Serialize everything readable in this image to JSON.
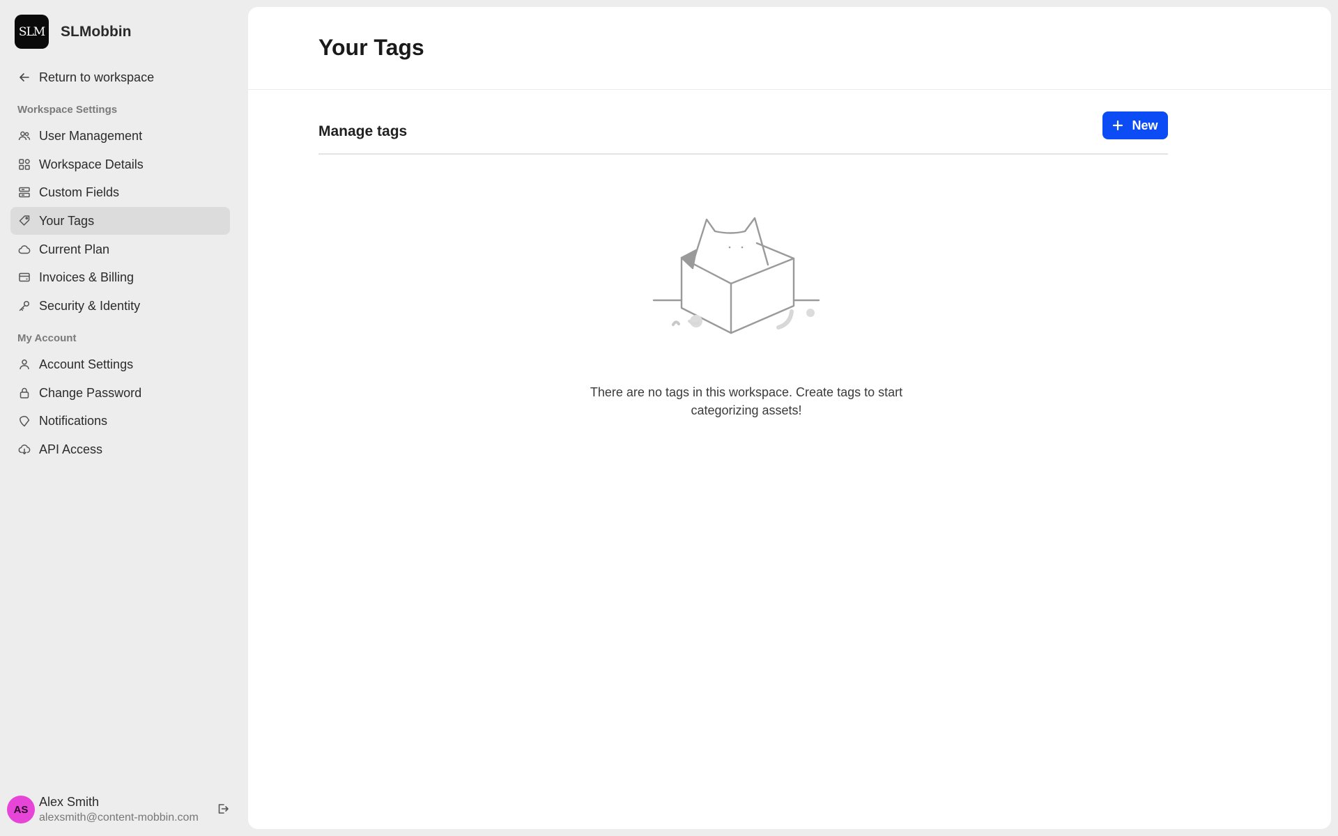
{
  "brand": {
    "logo_text": "SLM",
    "name": "SLMobbin"
  },
  "sidebar": {
    "return_label": "Return to workspace",
    "workspace_section": "Workspace Settings",
    "workspace_items": [
      {
        "label": "User Management",
        "icon": "users-icon"
      },
      {
        "label": "Workspace Details",
        "icon": "grid-icon"
      },
      {
        "label": "Custom Fields",
        "icon": "fields-icon"
      },
      {
        "label": "Your Tags",
        "icon": "tag-icon",
        "active": true
      },
      {
        "label": "Current Plan",
        "icon": "cloud-icon"
      },
      {
        "label": "Invoices & Billing",
        "icon": "card-icon"
      },
      {
        "label": "Security & Identity",
        "icon": "key-icon"
      }
    ],
    "account_section": "My Account",
    "account_items": [
      {
        "label": "Account Settings",
        "icon": "user-icon"
      },
      {
        "label": "Change Password",
        "icon": "lock-icon"
      },
      {
        "label": "Notifications",
        "icon": "bell-icon"
      },
      {
        "label": "API Access",
        "icon": "cloud-download-icon"
      }
    ]
  },
  "user": {
    "initials": "AS",
    "name": "Alex Smith",
    "email": "alexsmith@content-mobbin.com",
    "avatar_color": "#e645d7"
  },
  "main": {
    "title": "Your Tags",
    "section_title": "Manage tags",
    "new_button_label": "New",
    "empty_message": "There are no tags in this workspace. Create tags to start categorizing assets!"
  },
  "colors": {
    "accent": "#0b4cf5",
    "active_nav": "#dcdcdc"
  }
}
